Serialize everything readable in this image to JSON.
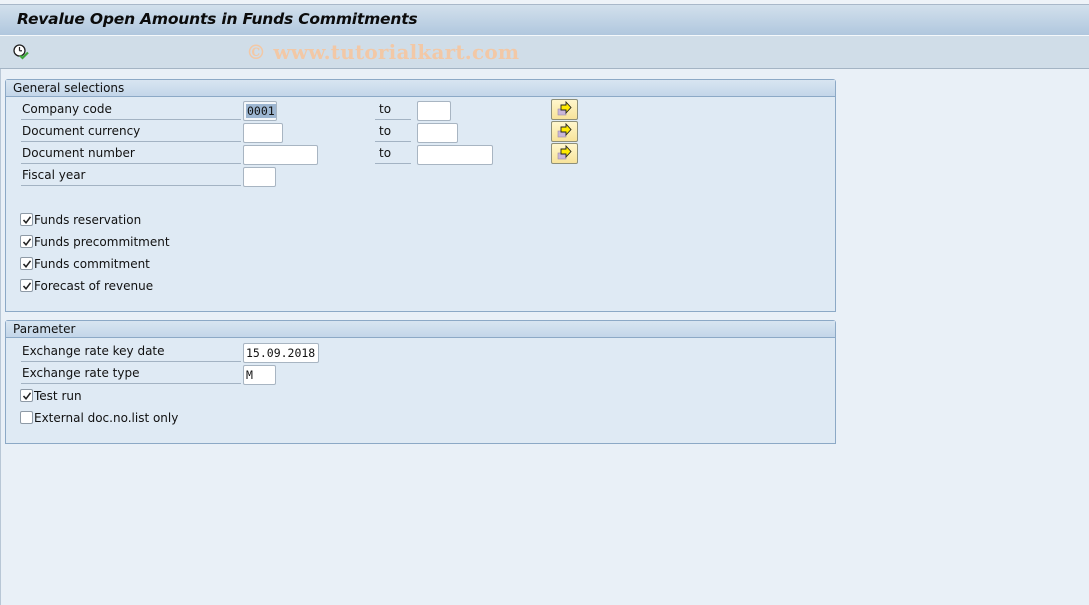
{
  "window": {
    "title": "Revalue Open Amounts in Funds Commitments"
  },
  "toolbar": {
    "execute_icon": "execute-clock-check-icon",
    "watermark": "© www.tutorialkart.com"
  },
  "general_selections": {
    "title": "General selections",
    "rows": [
      {
        "label": "Company code",
        "from_value": "0001",
        "to_label": "to",
        "to_value": "",
        "multi_icon": "multiple-selection-arrow-icon"
      },
      {
        "label": "Document currency",
        "from_value": "",
        "to_label": "to",
        "to_value": "",
        "multi_icon": "multiple-selection-arrow-icon"
      },
      {
        "label": "Document number",
        "from_value": "",
        "to_label": "to",
        "to_value": "",
        "multi_icon": "multiple-selection-arrow-icon"
      },
      {
        "label": "Fiscal year",
        "from_value": ""
      }
    ],
    "checkboxes": [
      {
        "label": "Funds reservation",
        "checked": true
      },
      {
        "label": "Funds precommitment",
        "checked": true
      },
      {
        "label": "Funds commitment",
        "checked": true
      },
      {
        "label": "Forecast of revenue",
        "checked": true
      }
    ]
  },
  "parameter": {
    "title": "Parameter",
    "fields": [
      {
        "label": "Exchange rate key date",
        "value": "15.09.2018"
      },
      {
        "label": "Exchange rate type",
        "value": "M"
      }
    ],
    "checkboxes": [
      {
        "label": "Test run",
        "checked": true
      },
      {
        "label": "External doc.no.list only",
        "checked": false
      }
    ]
  }
}
